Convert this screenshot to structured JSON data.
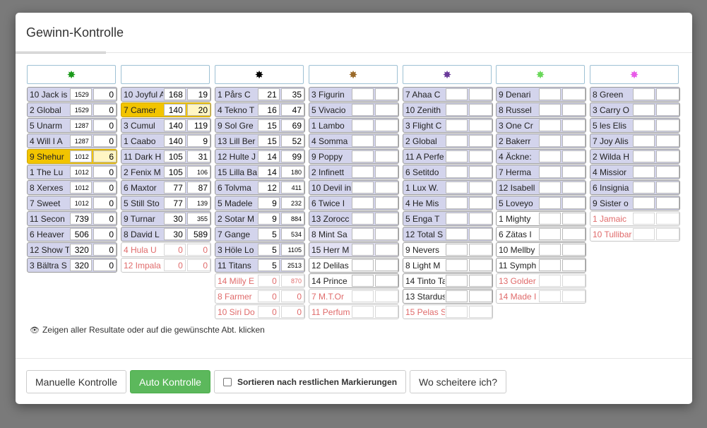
{
  "modal": {
    "title": "Gewinn-Kontrolle"
  },
  "star_colors": [
    "#1a9a1a",
    "#ffffff",
    "#000000",
    "#9a6a2a",
    "#6a3a9a",
    "#6ad85a",
    "#e85ae8"
  ],
  "columns": [
    {
      "rows": [
        {
          "l": "10 Jack is",
          "a": "1529",
          "b": "0"
        },
        {
          "l": "2 Global",
          "a": "1529",
          "b": "0"
        },
        {
          "l": "5 Unarm",
          "a": "1287",
          "b": "0"
        },
        {
          "l": "4 Will I A",
          "a": "1287",
          "b": "0"
        },
        {
          "l": "9 Shehur",
          "a": "1012",
          "b": "6",
          "s": "hl"
        },
        {
          "l": "1 The Lu",
          "a": "1012",
          "b": "0"
        },
        {
          "l": "8 Xerxes",
          "a": "1012",
          "b": "0"
        },
        {
          "l": "7 Sweet",
          "a": "1012",
          "b": "0"
        },
        {
          "l": "11 Secon",
          "a": "739",
          "b": "0"
        },
        {
          "l": "6 Heaver",
          "a": "506",
          "b": "0"
        },
        {
          "l": "12 Show T",
          "a": "320",
          "b": "0"
        },
        {
          "l": "3 Bältra S",
          "a": "320",
          "b": "0"
        }
      ]
    },
    {
      "rows": [
        {
          "l": "10 Joyful A",
          "a": "168",
          "b": "19"
        },
        {
          "l": "7 Camer",
          "a": "140",
          "b": "20",
          "s": "hl"
        },
        {
          "l": "3 Cumul",
          "a": "140",
          "b": "119"
        },
        {
          "l": "1 Caabo",
          "a": "140",
          "b": "9"
        },
        {
          "l": "11 Dark H",
          "a": "105",
          "b": "31"
        },
        {
          "l": "2 Fenix M",
          "a": "105",
          "b": "106"
        },
        {
          "l": "6 Maxtor",
          "a": "77",
          "b": "87"
        },
        {
          "l": "5 Still Sto",
          "a": "77",
          "b": "139"
        },
        {
          "l": "9 Turnar",
          "a": "30",
          "b": "355"
        },
        {
          "l": "8 David L",
          "a": "30",
          "b": "589"
        },
        {
          "l": "4 Hula U",
          "a": "0",
          "b": "0",
          "s": "red"
        },
        {
          "l": "12 Impala",
          "a": "0",
          "b": "0",
          "s": "red"
        }
      ]
    },
    {
      "rows": [
        {
          "l": "1 Pårs C",
          "a": "21",
          "b": "35"
        },
        {
          "l": "4 Tekno T",
          "a": "16",
          "b": "47"
        },
        {
          "l": "9 Sol Gre",
          "a": "15",
          "b": "69"
        },
        {
          "l": "13 Lill Ber",
          "a": "15",
          "b": "52"
        },
        {
          "l": "12 Hulte J",
          "a": "14",
          "b": "99"
        },
        {
          "l": "15 Lilla Ba",
          "a": "14",
          "b": "180"
        },
        {
          "l": "6 Tolvma",
          "a": "12",
          "b": "411"
        },
        {
          "l": "5 Madele",
          "a": "9",
          "b": "232"
        },
        {
          "l": "2 Sotar M",
          "a": "9",
          "b": "884"
        },
        {
          "l": "7 Gange",
          "a": "5",
          "b": "534"
        },
        {
          "l": "3 Höle Lo",
          "a": "5",
          "b": "1105"
        },
        {
          "l": "11 Titans",
          "a": "5",
          "b": "2513"
        },
        {
          "l": "14 Milly E",
          "a": "0",
          "b": "870",
          "s": "red"
        },
        {
          "l": "8 Farmer",
          "a": "0",
          "b": "0",
          "s": "red"
        },
        {
          "l": "10 Siri Do",
          "a": "0",
          "b": "0",
          "s": "red"
        }
      ]
    },
    {
      "rows": [
        {
          "l": "3 Figurin",
          "a": "",
          "b": ""
        },
        {
          "l": "5 Vivacio",
          "a": "",
          "b": ""
        },
        {
          "l": "1 Lambo",
          "a": "",
          "b": ""
        },
        {
          "l": "4 Somma",
          "a": "",
          "b": ""
        },
        {
          "l": "9 Poppy",
          "a": "",
          "b": ""
        },
        {
          "l": "2 Infinett",
          "a": "",
          "b": ""
        },
        {
          "l": "10 Devil in",
          "a": "",
          "b": ""
        },
        {
          "l": "6 Twice I",
          "a": "",
          "b": ""
        },
        {
          "l": "13 Zorocc",
          "a": "",
          "b": ""
        },
        {
          "l": "8 Mint Sa",
          "a": "",
          "b": "",
          "s": "lav"
        },
        {
          "l": "15 Herr M",
          "a": "",
          "b": "",
          "s": "lav"
        },
        {
          "l": "12 Delilas",
          "a": "",
          "b": "",
          "s": "white"
        },
        {
          "l": "14 Prince",
          "a": "",
          "b": "",
          "s": "white"
        },
        {
          "l": "7 M.T.Or",
          "a": "",
          "b": "",
          "s": "red"
        },
        {
          "l": "11 Perfum",
          "a": "",
          "b": "",
          "s": "red"
        }
      ]
    },
    {
      "rows": [
        {
          "l": "7 Ahaa C",
          "a": "",
          "b": ""
        },
        {
          "l": "10 Zenith",
          "a": "",
          "b": ""
        },
        {
          "l": "3 Flight C",
          "a": "",
          "b": ""
        },
        {
          "l": "2 Global",
          "a": "",
          "b": ""
        },
        {
          "l": "11 A Perfe",
          "a": "",
          "b": ""
        },
        {
          "l": "6 Setitdo",
          "a": "",
          "b": ""
        },
        {
          "l": "1 Lux W.",
          "a": "",
          "b": ""
        },
        {
          "l": "4 He Mis",
          "a": "",
          "b": ""
        },
        {
          "l": "5 Enga T",
          "a": "",
          "b": ""
        },
        {
          "l": "12 Total S",
          "a": "",
          "b": ""
        },
        {
          "l": "9 Nevers",
          "a": "",
          "b": "",
          "s": "white"
        },
        {
          "l": "8 Light M",
          "a": "",
          "b": "",
          "s": "white"
        },
        {
          "l": "14 Tinto Ta",
          "a": "",
          "b": "",
          "s": "white"
        },
        {
          "l": "13 Stardus",
          "a": "",
          "b": "",
          "s": "white"
        },
        {
          "l": "15 Pelas S",
          "a": "",
          "b": "",
          "s": "red"
        }
      ]
    },
    {
      "rows": [
        {
          "l": "9 Denari",
          "a": "",
          "b": ""
        },
        {
          "l": "8 Russel",
          "a": "",
          "b": ""
        },
        {
          "l": "3 One Cr",
          "a": "",
          "b": ""
        },
        {
          "l": "2 Bakerr",
          "a": "",
          "b": ""
        },
        {
          "l": "4 Äckne:",
          "a": "",
          "b": ""
        },
        {
          "l": "7 Herma",
          "a": "",
          "b": ""
        },
        {
          "l": "12 Isabell",
          "a": "",
          "b": ""
        },
        {
          "l": "5 Loveyo",
          "a": "",
          "b": ""
        },
        {
          "l": "1 Mighty",
          "a": "",
          "b": "",
          "s": "white"
        },
        {
          "l": "6 Zätas I",
          "a": "",
          "b": "",
          "s": "white"
        },
        {
          "l": "10 Mellby",
          "a": "",
          "b": "",
          "s": "white"
        },
        {
          "l": "11 Symph",
          "a": "",
          "b": "",
          "s": "white"
        },
        {
          "l": "13 Golder",
          "a": "",
          "b": "",
          "s": "red"
        },
        {
          "l": "14 Made I",
          "a": "",
          "b": "",
          "s": "red"
        }
      ]
    },
    {
      "rows": [
        {
          "l": "8 Green",
          "a": "",
          "b": ""
        },
        {
          "l": "3 Carry O",
          "a": "",
          "b": ""
        },
        {
          "l": "5 les Elis",
          "a": "",
          "b": ""
        },
        {
          "l": "7 Joy Alis",
          "a": "",
          "b": ""
        },
        {
          "l": "2 Wilda H",
          "a": "",
          "b": ""
        },
        {
          "l": "4 Missior",
          "a": "",
          "b": ""
        },
        {
          "l": "6 Insignia",
          "a": "",
          "b": ""
        },
        {
          "l": "9 Sister o",
          "a": "",
          "b": ""
        },
        {
          "l": "1 Jamaic",
          "a": "",
          "b": "",
          "s": "red"
        },
        {
          "l": "10 Tullibar",
          "a": "",
          "b": "",
          "s": "red"
        }
      ]
    }
  ],
  "hint": {
    "icon": "eye-icon",
    "text": "Zeigen aller Resultate oder auf die gewünschte Abt. klicken"
  },
  "footer": {
    "manual": "Manuelle Kontrolle",
    "auto": "Auto Kontrolle",
    "sort": "Sortieren nach restlichen Markierungen",
    "fail": "Wo scheitere ich?"
  }
}
